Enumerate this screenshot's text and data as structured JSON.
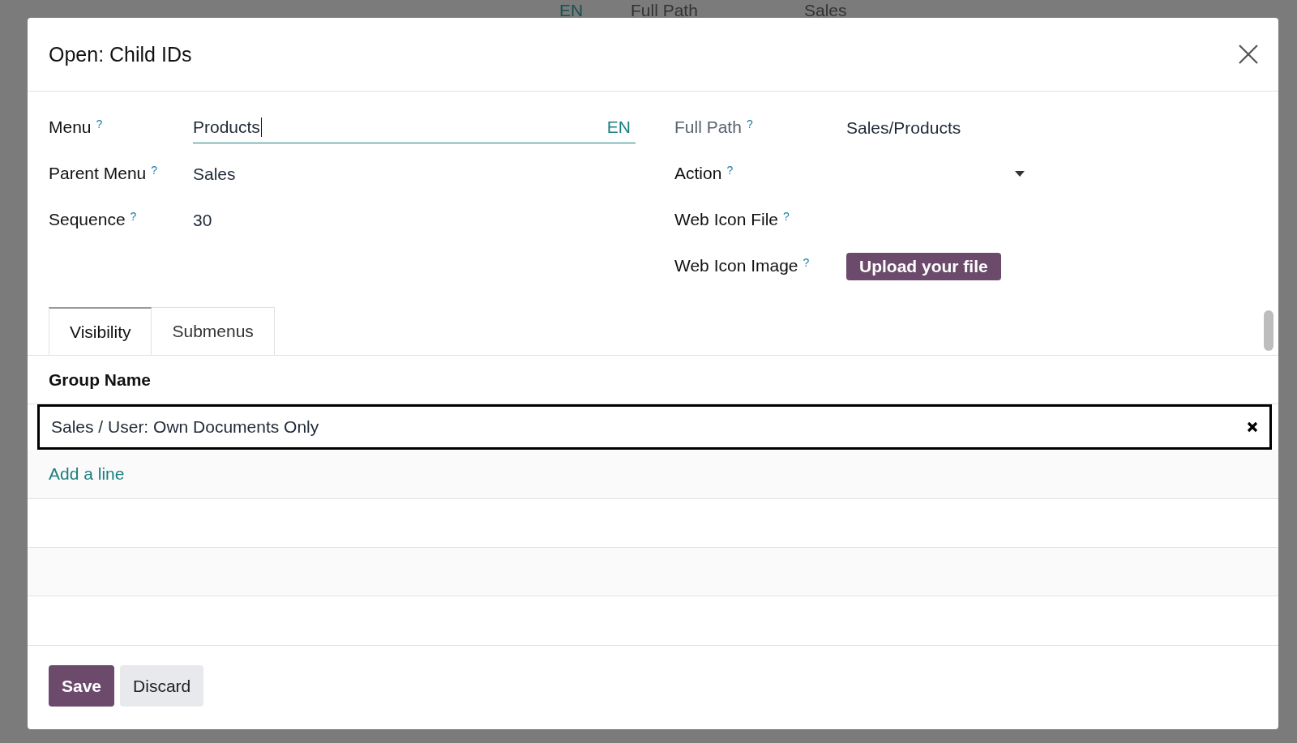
{
  "background": {
    "texts": [
      "EN",
      "Full Path",
      "Sales"
    ]
  },
  "dialog": {
    "title": "Open: Child IDs",
    "left_fields": [
      {
        "kind": "input",
        "label": "Menu",
        "help": "?",
        "value": "Products",
        "suffix": "EN"
      },
      {
        "kind": "text",
        "label": "Parent Menu",
        "help": "?",
        "value": "Sales"
      },
      {
        "kind": "text",
        "label": "Sequence",
        "help": "?",
        "value": "30"
      }
    ],
    "right_fields": [
      {
        "kind": "readonly",
        "label": "Full Path",
        "help": "?",
        "value": "Sales/Products"
      },
      {
        "kind": "select",
        "label": "Action",
        "help": "?"
      },
      {
        "kind": "empty",
        "label": "Web Icon File",
        "help": "?"
      },
      {
        "kind": "upload",
        "label": "Web Icon Image",
        "help": "?",
        "button": "Upload your file"
      }
    ],
    "tabs": [
      {
        "label": "Visibility",
        "selected": true
      },
      {
        "label": "Submenus",
        "selected": false
      }
    ],
    "table": {
      "columns": [
        "Group Name"
      ],
      "rows": [
        {
          "cells": [
            "Sales / User: Own Documents Only"
          ],
          "selected": true
        }
      ],
      "add_line": "Add a line"
    },
    "buttons": [
      {
        "label": "Save",
        "kind": "primary"
      },
      {
        "label": "Discard",
        "kind": "secondary"
      }
    ]
  }
}
